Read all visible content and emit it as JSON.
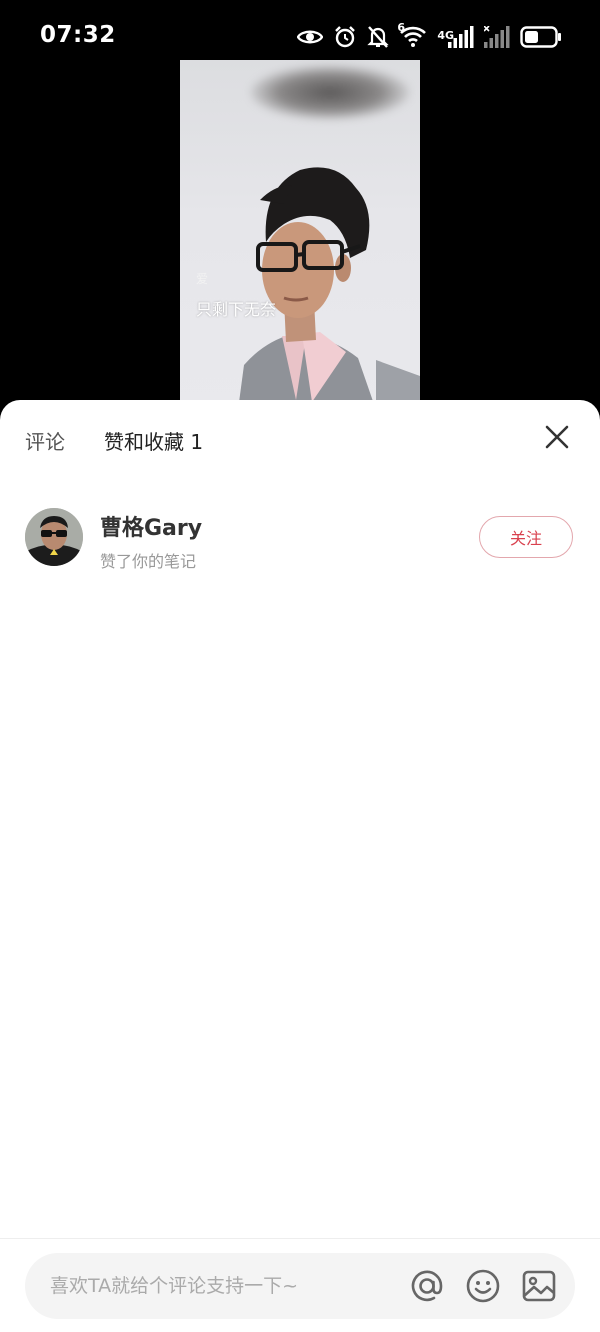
{
  "status_bar": {
    "time": "07:32",
    "network_sim1": "4G",
    "network_sim1_slot": "6",
    "icons": [
      "eye-icon",
      "alarm-icon",
      "mute-icon",
      "wifi-icon",
      "signal-icon",
      "battery-icon"
    ]
  },
  "video": {
    "caption_small": "爱",
    "caption": "只剩下无奈"
  },
  "sheet": {
    "tabs": [
      {
        "label": "评论"
      },
      {
        "label": "赞和收藏 1"
      }
    ],
    "users": [
      {
        "name": "曹格Gary",
        "action": "赞了你的笔记",
        "follow_label": "关注"
      }
    ],
    "comment_bar": {
      "placeholder": "喜欢TA就给个评论支持一下~"
    }
  },
  "colors": {
    "accent": "#d9414e",
    "follow_border": "#e3a7ad",
    "sheet_bg": "#ffffff",
    "input_bg": "#f4f4f4"
  }
}
